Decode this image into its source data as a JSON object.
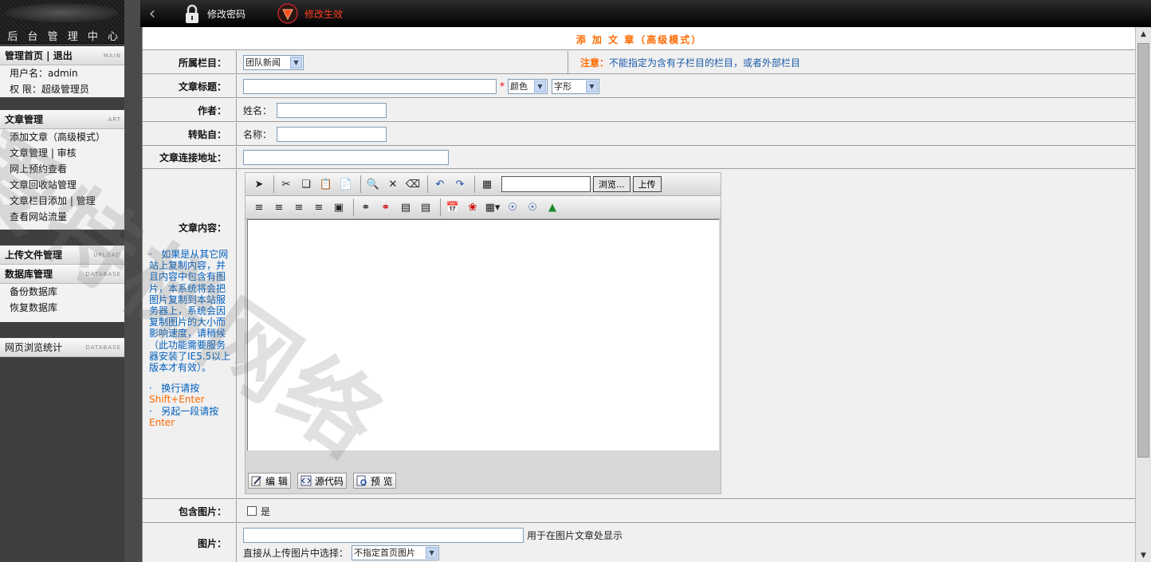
{
  "sidebar": {
    "logo_title": "后 台 管 理 中 心",
    "sections": [
      {
        "title": "管理首页 | 退出",
        "tag": "MAIN",
        "items": [
          "用户名：admin",
          "权 限：超级管理员"
        ]
      },
      {
        "title": "文章管理",
        "tag": "ART",
        "items": [
          "添加文章（高级模式）",
          "文章管理 | 审核",
          "网上预约查看",
          "文章回收站管理",
          "文章栏目添加 | 管理",
          "查看网站流量"
        ]
      },
      {
        "title": "上传文件管理",
        "tag": "UPLOAD",
        "items": []
      },
      {
        "title": "数据库管理",
        "tag": "DATABASE",
        "items": [
          "备份数据库",
          "恢复数据库"
        ]
      },
      {
        "title": "网页浏览统计",
        "tag": "DATABASE",
        "items": []
      }
    ]
  },
  "topbar": {
    "change_password": "修改密码",
    "apply_changes": "修改生效"
  },
  "form": {
    "header_title": "添 加 文 章（高级模式）",
    "category_label": "所属栏目：",
    "category_value": "团队新闻",
    "note_prefix": "注意：",
    "note_text": "不能指定为含有子栏目的栏目，或者外部栏目",
    "title_label": "文章标题：",
    "required_mark": "*",
    "color_select": "颜色",
    "font_select": "字形",
    "author_label": "作者：",
    "author_name_label": "姓名：",
    "source_label": "转贴自：",
    "source_name_label": "名称：",
    "link_label": "文章连接地址：",
    "content_label": "文章内容：",
    "hint1": "如果是从其它网站上复制内容，并且内容中包含有图片，本系统将会把图片复制到本站服务器上，系统会因复制图片的大小而影响速度，请稍候（此功能需要服务器安装了IE5.5以上版本才有效）。",
    "hint2_prefix": "换行请按",
    "hint2_key": "Shift+Enter",
    "hint3_prefix": "另起一段请按",
    "hint3_key": "Enter",
    "bullet": "·",
    "include_image_label": "包含图片：",
    "include_image_option": "是",
    "image_label": "图片：",
    "image_hint": "用于在图片文章处显示",
    "upload_select_label": "直接从上传图片中选择：",
    "upload_select_value": "不指定首页图片"
  },
  "editor": {
    "browse_button": "浏览...",
    "upload_button": "上传",
    "mode_edit": "编 辑",
    "mode_source": "源代码",
    "mode_preview": "预 览",
    "icons_row1": [
      "pointer-icon",
      "cut-icon",
      "copy-icon",
      "paste-icon",
      "paste-text-icon",
      "find-icon",
      "delete-icon",
      "eraser-icon",
      "undo-icon",
      "redo-icon",
      "calculator-icon"
    ],
    "icons_row2": [
      "align-left-icon",
      "align-center-icon",
      "align-right-icon",
      "justify-icon",
      "box-icon",
      "link-icon",
      "unlink-icon",
      "hr-icon",
      "hr-dash-icon",
      "date-icon",
      "special-char-icon",
      "table-icon",
      "insert-row-icon",
      "insert-col-icon",
      "image-icon"
    ]
  },
  "watermark": "爱特梯网络",
  "colors": {
    "accent_orange": "#ff6a00",
    "hint_blue": "#005ebd",
    "topbar_red": "#ff3c1e"
  }
}
